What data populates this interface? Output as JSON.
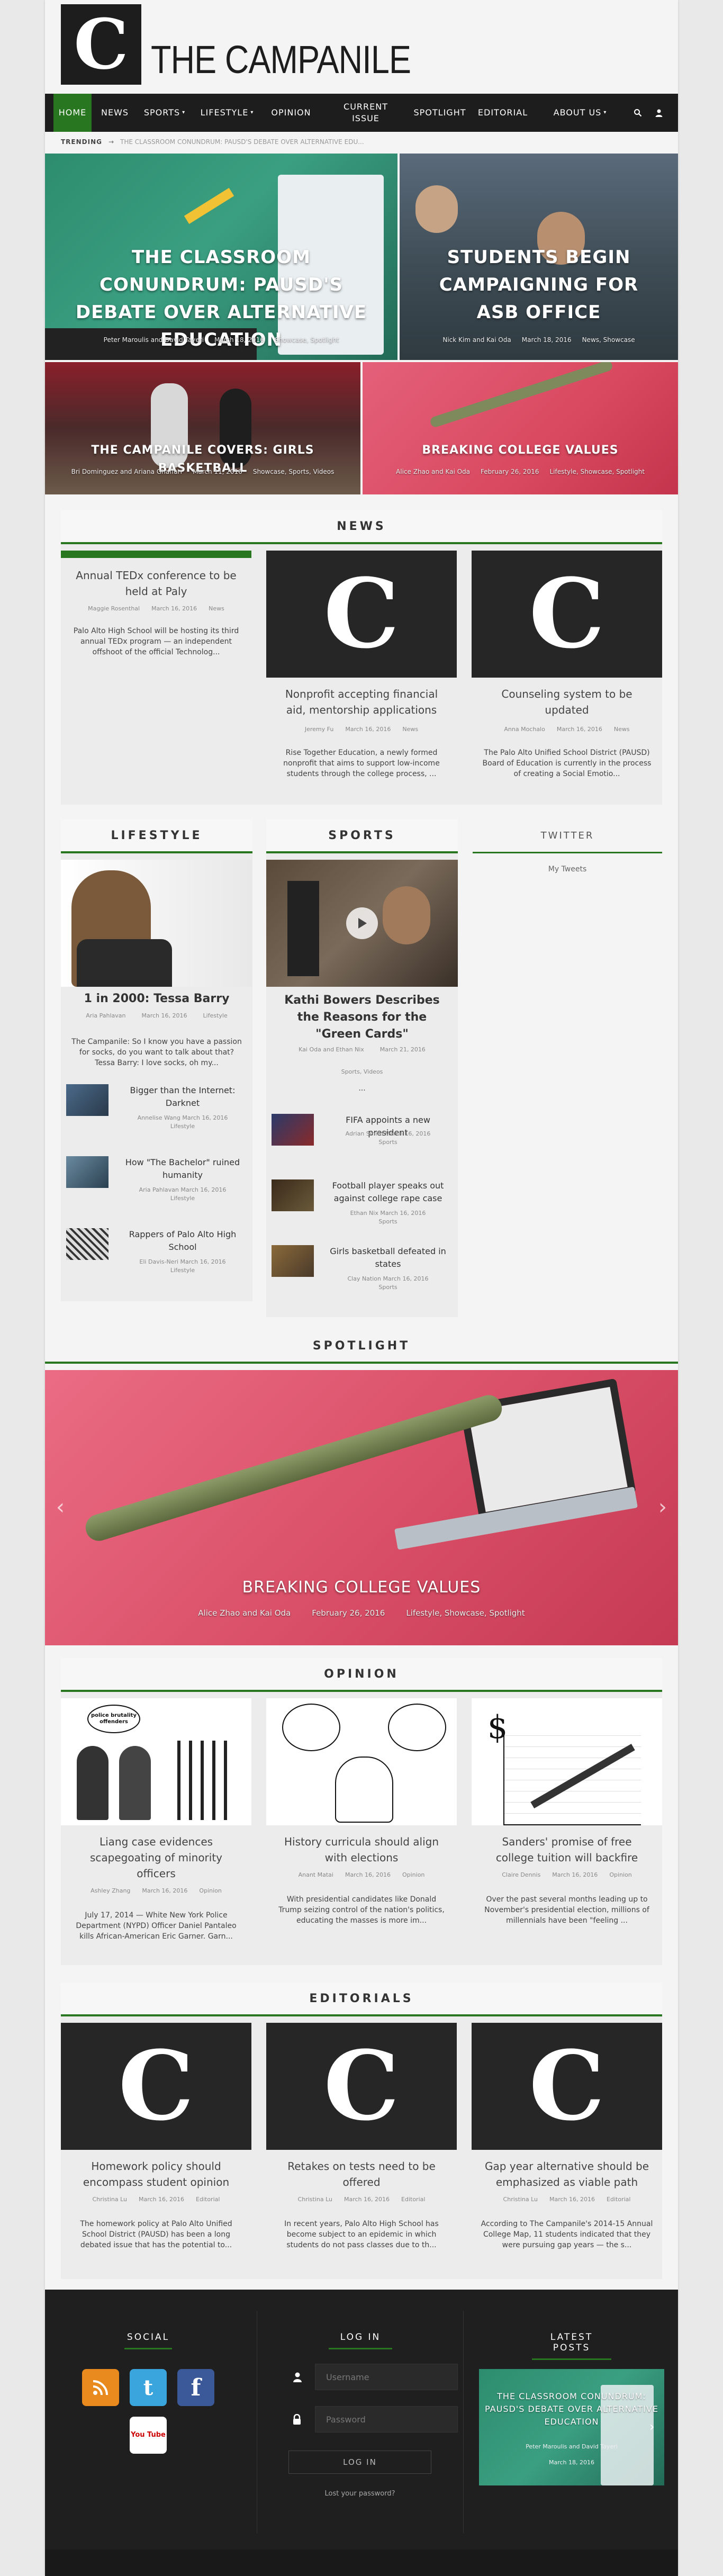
{
  "site": {
    "title": "THE CAMPANILE",
    "logo_letter": "C"
  },
  "nav": {
    "items": [
      {
        "label": "HOME",
        "active": true
      },
      {
        "label": "NEWS"
      },
      {
        "label": "SPORTS",
        "caret": "▾"
      },
      {
        "label": "LIFESTYLE",
        "caret": "▾"
      },
      {
        "label": "OPINION"
      },
      {
        "label": "CURRENT ISSUE"
      },
      {
        "label": "SPOTLIGHT"
      },
      {
        "label": "EDITORIAL"
      },
      {
        "label": "ABOUT US",
        "caret": "▾"
      }
    ],
    "search_icon": "search-icon",
    "user_icon": "user-icon"
  },
  "trending": {
    "label": "TRENDING",
    "arrow": "→",
    "text": "THE CLASSROOM CONUNDRUM: PAUSD'S DEBATE OVER ALTERNATIVE EDU..."
  },
  "heroes": [
    {
      "title": "THE CLASSROOM CONUNDRUM: PAUSD'S DEBATE OVER ALTERNATIVE EDUCATION",
      "author": "Peter Maroulis and David Tayeri",
      "date": "March 18, 2016",
      "cats": "Showcase, Spotlight"
    },
    {
      "title": "STUDENTS BEGIN CAMPAIGNING FOR ASB OFFICE",
      "author": "Nick Kim and Kai Oda",
      "date": "March 18, 2016",
      "cats": "News, Showcase"
    },
    {
      "title": "THE CAMPANILE COVERS: GIRLS BASKETBALL",
      "author": "Bri Dominguez and Ariana Ghaffari",
      "date": "March 11, 2016",
      "cats": "Showcase, Sports, Videos"
    },
    {
      "title": "BREAKING COLLEGE VALUES",
      "author": "Alice Zhao and Kai Oda",
      "date": "February 26, 2016",
      "cats": "Lifestyle, Showcase, Spotlight"
    }
  ],
  "news": {
    "heading": "NEWS",
    "cards": [
      {
        "title": "Annual TEDx conference to be held at Paly",
        "author": "Maggie Rosenthal",
        "date": "March 16, 2016",
        "cat": "News",
        "excerpt": "Palo Alto High School will be hosting its third annual TEDx program — an independent offshoot of the official Technolog..."
      },
      {
        "title": "Nonprofit accepting financial aid, mentorship applications",
        "author": "Jeremy Fu",
        "date": "March 16, 2016",
        "cat": "News",
        "excerpt": "Rise Together Education, a newly formed nonprofit that aims to support low-income students through the college process, ..."
      },
      {
        "title": "Counseling system to be updated",
        "author": "Anna Mochalo",
        "date": "March 16, 2016",
        "cat": "News",
        "excerpt": "The Palo Alto Unified School District (PAUSD) Board of Education is currently in the process of creating a Social Emotio..."
      }
    ]
  },
  "lifestyle": {
    "heading": "LIFESTYLE",
    "main": {
      "title": "1 in 2000: Tessa Barry",
      "author": "Aria Pahlavan",
      "date": "March 16, 2016",
      "cat": "Lifestyle",
      "excerpt": "The Campanile: So I know you have a passion for socks, do you want to talk about that? Tessa Barry: I love socks, oh my..."
    },
    "items": [
      {
        "title": "Bigger than the Internet: Darknet",
        "author": "Annelise Wang",
        "date": "March 16, 2016",
        "cat": "Lifestyle"
      },
      {
        "title": "How \"The Bachelor\" ruined humanity",
        "author": "Aria Pahlavan",
        "date": "March 16, 2016",
        "cat": "Lifestyle"
      },
      {
        "title": "Rappers of Palo Alto High School",
        "author": "Eli Davis-Neri",
        "date": "March 16, 2016",
        "cat": "Lifestyle"
      }
    ]
  },
  "sports": {
    "heading": "SPORTS",
    "main": {
      "title": "Kathi Bowers Describes the Reasons for the \"Green Cards\"",
      "author": "Kai Oda and Ethan Nix",
      "date": "March 21, 2016",
      "cats": "Sports, Videos",
      "ellipsis": "..."
    },
    "items": [
      {
        "title": "FIFA appoints a new president",
        "author": "Adrian Smith",
        "date": "March 16, 2016",
        "cat": "Sports"
      },
      {
        "title": "Football player speaks out against college rape case",
        "author": "Ethan Nix",
        "date": "March 16, 2016",
        "cat": "Sports"
      },
      {
        "title": "Girls basketball defeated in states",
        "author": "Clay Nation",
        "date": "March 16, 2016",
        "cat": "Sports"
      }
    ]
  },
  "twitter": {
    "heading": "TWITTER",
    "link": "My Tweets"
  },
  "spotlight": {
    "heading": "SPOTLIGHT",
    "title": "BREAKING COLLEGE VALUES",
    "author": "Alice Zhao and Kai Oda",
    "date": "February 26, 2016",
    "cats": "Lifestyle, Showcase, Spotlight",
    "prev": "‹",
    "next": "›"
  },
  "opinion": {
    "heading": "OPINION",
    "cards": [
      {
        "title": "Liang case evidences scapegoating of minority officers",
        "author": "Ashley Zhang",
        "date": "March 16, 2016",
        "cat": "Opinion",
        "excerpt": "July 17, 2014 — White New York Police Department (NYPD) Officer Daniel Pantaleo kills African-American Eric Garner. Garn...",
        "art_text": "police brutality offenders"
      },
      {
        "title": "History curricula should align with elections",
        "author": "Anant Matai",
        "date": "March 16, 2016",
        "cat": "Opinion",
        "excerpt": "With presidential candidates like Donald Trump seizing control of the nation's politics, educating the masses is more im..."
      },
      {
        "title": "Sanders' promise of free college tuition will backfire",
        "author": "Claire Dennis",
        "date": "March 16, 2016",
        "cat": "Opinion",
        "excerpt": "Over the past several months leading up to November's presidential election, millions of millennials have been \"feeling ..."
      }
    ]
  },
  "editorials": {
    "heading": "EDITORIALS",
    "cards": [
      {
        "title": "Homework policy should encompass student opinion",
        "author": "Christina Lu",
        "date": "March 16, 2016",
        "cat": "Editorial",
        "excerpt": "The homework policy at Palo Alto Unified School District (PAUSD) has been a long debated issue that has the potential to..."
      },
      {
        "title": "Retakes on tests need to be offered",
        "author": "Christina Lu",
        "date": "March 16, 2016",
        "cat": "Editorial",
        "excerpt": "In recent years, Palo Alto High School has become subject to an epidemic in which students do not pass classes due to th..."
      },
      {
        "title": "Gap year alternative should be emphasized as viable path",
        "author": "Christina Lu",
        "date": "March 16, 2016",
        "cat": "Editorial",
        "excerpt": "According to The Campanile's 2014-15 Annual College Map, 11 students indicated that they were pursuing gap years — the s..."
      }
    ]
  },
  "footer": {
    "social_heading": "SOCIAL",
    "login_heading": "LOG IN",
    "latest_heading": "LATEST POSTS",
    "username_placeholder": "Username",
    "password_placeholder": "Password",
    "login_button": "LOG IN",
    "lost_password": "Lost your password?",
    "social": [
      {
        "icon": "rss-icon",
        "glyph": "◉",
        "color": "#e88a1e"
      },
      {
        "icon": "twitter-icon",
        "glyph": "t",
        "color": "#3aa4dd"
      },
      {
        "icon": "facebook-icon",
        "glyph": "f",
        "color": "#3b5998"
      },
      {
        "icon": "youtube-icon",
        "glyph": "You Tube",
        "color": "#ffffff"
      }
    ],
    "latest": {
      "title": "THE CLASSROOM CONUNDRUM: PAUSD'S DEBATE OVER ALTERNATIVE EDUCATION",
      "author": "Peter Maroulis and David Tayeri",
      "date": "March 18, 2016"
    }
  },
  "colors": {
    "accent": "#28761f",
    "dark": "#1d1d1d"
  }
}
